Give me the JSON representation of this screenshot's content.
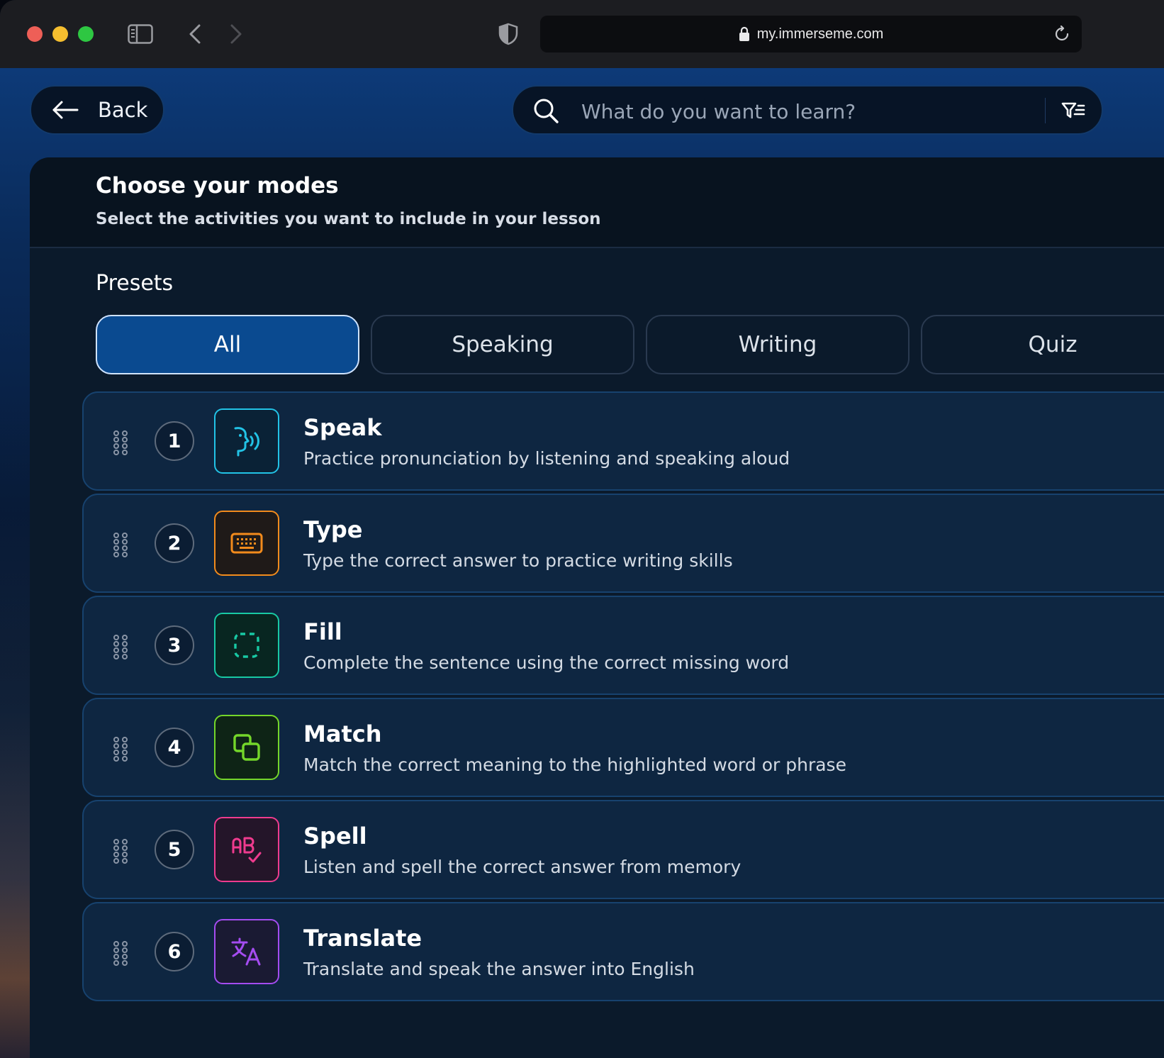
{
  "browser": {
    "url": "my.immerseme.com"
  },
  "header": {
    "back_label": "Back",
    "search_placeholder": "What do you want to learn?"
  },
  "panel": {
    "title": "Choose your modes",
    "subtitle": "Select the activities you want to include in your lesson",
    "presets_label": "Presets",
    "presets": [
      {
        "label": "All",
        "active": true
      },
      {
        "label": "Speaking",
        "active": false
      },
      {
        "label": "Writing",
        "active": false
      },
      {
        "label": "Quiz",
        "active": false
      }
    ]
  },
  "modes": [
    {
      "number": "1",
      "title": "Speak",
      "description": "Practice pronunciation by listening and speaking aloud",
      "icon": "speak-icon",
      "color": "#22c3e6",
      "bg": "#0a2236"
    },
    {
      "number": "2",
      "title": "Type",
      "description": "Type the correct answer to practice writing skills",
      "icon": "keyboard-icon",
      "color": "#f28b1c",
      "bg": "#1f1a18"
    },
    {
      "number": "3",
      "title": "Fill",
      "description": "Complete the sentence using the correct missing word",
      "icon": "fill-blank-icon",
      "color": "#18c9a4",
      "bg": "#082621"
    },
    {
      "number": "4",
      "title": "Match",
      "description": "Match the correct meaning to the highlighted word or phrase",
      "icon": "match-icon",
      "color": "#74d62a",
      "bg": "#0e2416"
    },
    {
      "number": "5",
      "title": "Spell",
      "description": "Listen and spell the correct answer from memory",
      "icon": "spell-icon",
      "color": "#ef3b8e",
      "bg": "#241529"
    },
    {
      "number": "6",
      "title": "Translate",
      "description": "Translate and speak the answer into English",
      "icon": "translate-icon",
      "color": "#a44cf0",
      "bg": "#1a1a33"
    }
  ]
}
